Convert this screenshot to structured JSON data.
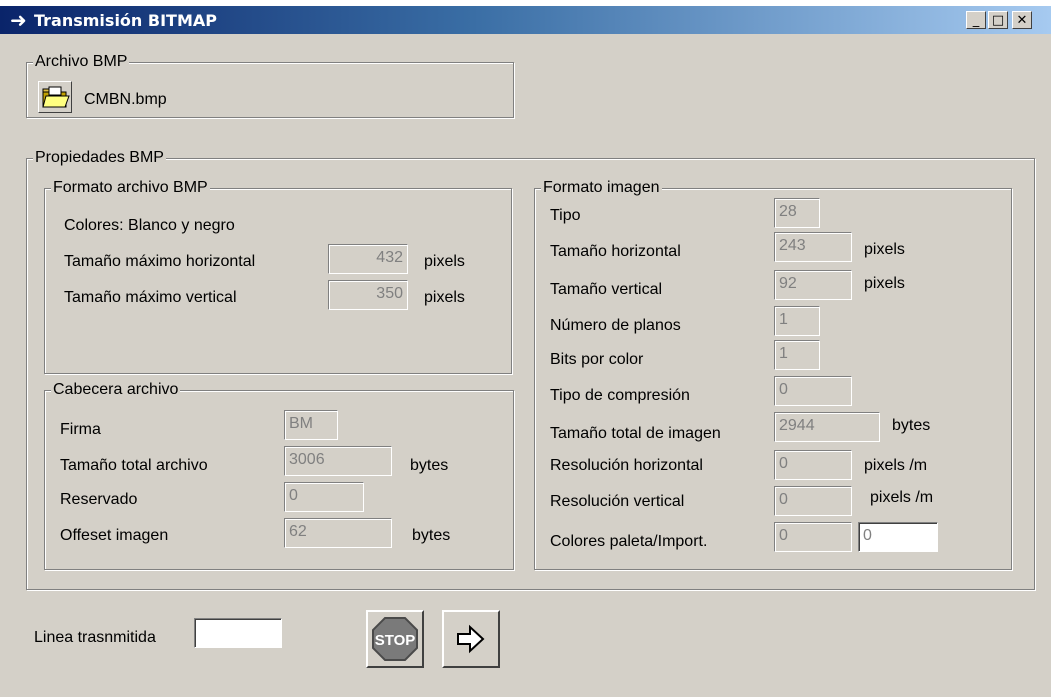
{
  "window": {
    "title": "Transmisión BITMAP",
    "title_icon": "arrow-right-icon",
    "controls": {
      "minimize": "_",
      "maximize": "□",
      "close": "✕"
    }
  },
  "archivo": {
    "legend": "Archivo BMP",
    "filename": "CMBN.bmp",
    "icon": "open-folder-icon"
  },
  "propiedades": {
    "legend": "Propiedades BMP",
    "formato_archivo": {
      "legend": "Formato archivo BMP",
      "colores": "Colores: Blanco y negro",
      "max_h_label": "Tamaño máximo horizontal",
      "max_h_value": "432",
      "max_h_unit": "pixels",
      "max_v_label": "Tamaño máximo vertical",
      "max_v_value": "350",
      "max_v_unit": "pixels"
    },
    "cabecera": {
      "legend": "Cabecera archivo",
      "firma_label": "Firma",
      "firma_value": "BM",
      "total_label": "Tamaño total archivo",
      "total_value": "3006",
      "total_unit": "bytes",
      "reservado_label": "Reservado",
      "reservado_value": "0",
      "offset_label": "Offeset imagen",
      "offset_value": "62",
      "offset_unit": "bytes"
    },
    "formato_imagen": {
      "legend": "Formato imagen",
      "tipo_label": "Tipo",
      "tipo_value": "28",
      "th_label": "Tamaño horizontal",
      "th_value": "243",
      "th_unit": "pixels",
      "tv_label": "Tamaño vertical",
      "tv_value": "92",
      "tv_unit": "pixels",
      "planos_label": "Número de planos",
      "planos_value": "1",
      "bits_label": "Bits por color",
      "bits_value": "1",
      "compresion_label": "Tipo de compresión",
      "compresion_value": "0",
      "total_img_label": "Tamaño total de imagen",
      "total_img_value": "2944",
      "total_img_unit": "bytes",
      "res_h_label": "Resolución horizontal",
      "res_h_value": "0",
      "res_h_unit": "pixels /m",
      "res_v_label": "Resolución vertical",
      "res_v_value": "0",
      "res_v_unit": "pixels /m",
      "paleta_label": "Colores paleta/Import.",
      "paleta_value": "0",
      "import_value": "0"
    }
  },
  "footer": {
    "linea_label": "Linea trasnmitida",
    "linea_value": "",
    "stop_label": "STOP",
    "stop_icon": "stop-sign-icon",
    "send_icon": "arrow-right-outline-icon"
  }
}
